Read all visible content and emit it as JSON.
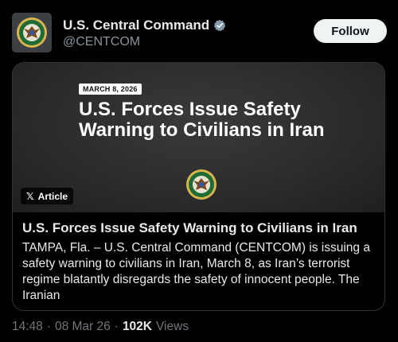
{
  "account": {
    "display_name": "U.S. Central Command",
    "handle": "@CENTCOM",
    "verified": true,
    "follow_label": "Follow"
  },
  "card": {
    "date_badge": "MARCH 8, 2026",
    "image_headline": "U.S. Forces Issue Safety Warning to Civilians in Iran",
    "article_tag": "Article",
    "title": "U.S. Forces Issue Safety Warning to Civilians in Iran",
    "description": "TAMPA, Fla. – U.S. Central Command (CENTCOM) is issuing a safety warning to civilians in Iran, March 8, as Iran’s terrorist regime blatantly disregards the safety of innocent people. The Iranian"
  },
  "meta": {
    "time": "14:48",
    "separator": "·",
    "date": "08 Mar 26",
    "views_count": "102K",
    "views_label": "Views"
  },
  "colors": {
    "background": "#000000",
    "text_primary": "#e7e9ea",
    "text_secondary": "#71767b",
    "follow_button_bg": "#eff3f4",
    "card_border": "#2f3336",
    "seal_green": "#1e6b36"
  },
  "icons": [
    "centcom-seal-icon",
    "verified-badge-icon",
    "x-logo-icon"
  ]
}
